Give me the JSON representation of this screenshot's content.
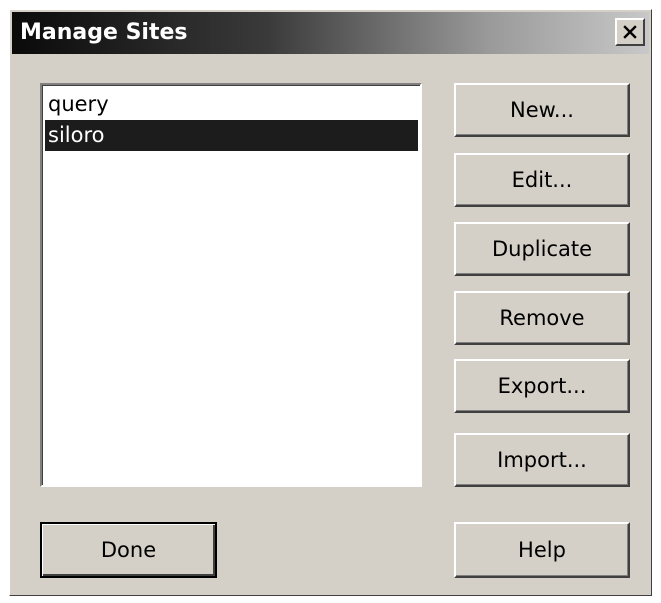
{
  "window": {
    "title": "Manage Sites",
    "close_icon": "close-icon"
  },
  "sites": {
    "items": [
      {
        "label": "query",
        "selected": false
      },
      {
        "label": "siloro",
        "selected": true
      }
    ]
  },
  "buttons": {
    "new": "New...",
    "edit": "Edit...",
    "duplicate": "Duplicate",
    "remove": "Remove",
    "export": "Export...",
    "import": "Import...",
    "done": "Done",
    "help": "Help"
  },
  "colors": {
    "dialog_face": "#d4d0c8",
    "selection": "#1c1c1c"
  }
}
